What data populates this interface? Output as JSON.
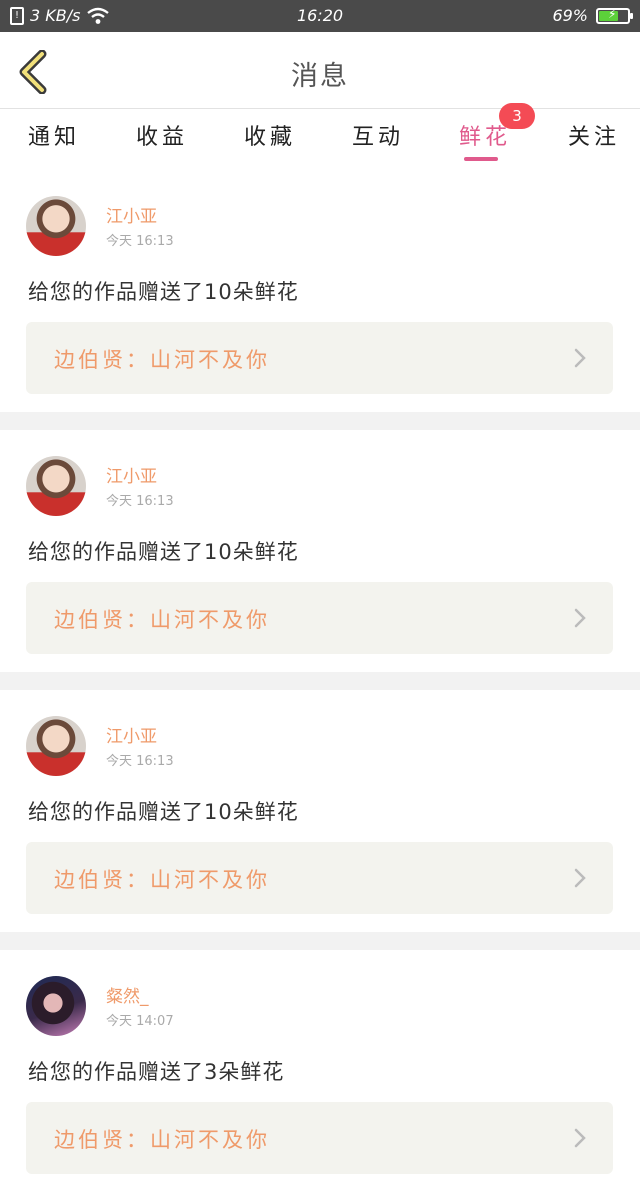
{
  "status_bar": {
    "speed": "3 KB/s",
    "time": "16:20",
    "battery_percent": "69%",
    "battery_level": 0.69
  },
  "header": {
    "title": "消息"
  },
  "tabs": [
    {
      "label": "通知"
    },
    {
      "label": "收益"
    },
    {
      "label": "收藏"
    },
    {
      "label": "互动"
    },
    {
      "label": "鲜花",
      "badge": "3",
      "active": true
    },
    {
      "label": "关注"
    }
  ],
  "colors": {
    "accent": "#e05a8c",
    "badge": "#f44b55",
    "name": "#ef9a6a"
  },
  "messages": [
    {
      "user": "江小亚",
      "time": "今天 16:13",
      "text": "给您的作品赠送了10朵鲜花",
      "work": "边伯贤：山河不及你"
    },
    {
      "user": "江小亚",
      "time": "今天 16:13",
      "text": "给您的作品赠送了10朵鲜花",
      "work": "边伯贤：山河不及你"
    },
    {
      "user": "江小亚",
      "time": "今天 16:13",
      "text": "给您的作品赠送了10朵鲜花",
      "work": "边伯贤：山河不及你"
    },
    {
      "user": "粲然_",
      "time": "今天 14:07",
      "text": "给您的作品赠送了3朵鲜花",
      "work": "边伯贤：山河不及你"
    }
  ]
}
